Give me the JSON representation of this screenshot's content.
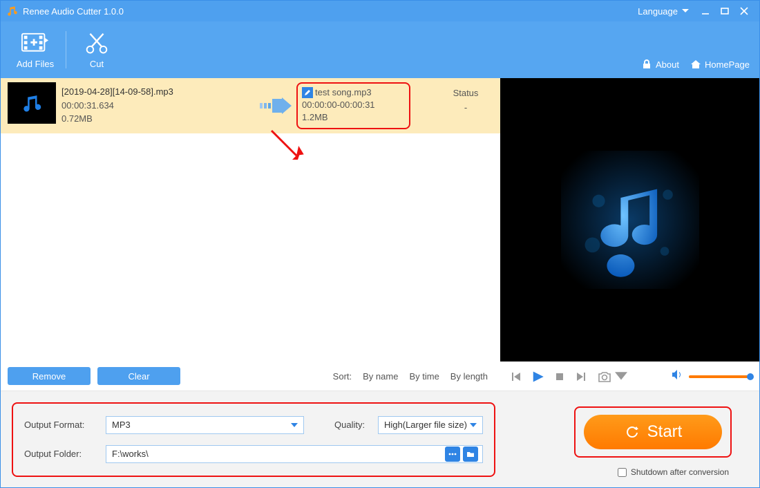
{
  "titlebar": {
    "title": "Renee Audio Cutter 1.0.0",
    "language_label": "Language"
  },
  "toolbar": {
    "add_files_label": "Add Files",
    "cut_label": "Cut",
    "about_label": "About",
    "homepage_label": "HomePage"
  },
  "list": {
    "item": {
      "source_name": "[2019-04-28][14-09-58].mp3",
      "source_duration": "00:00:31.634",
      "source_size": "0.72MB",
      "dest_name": "test song.mp3",
      "dest_range": "00:00:00-00:00:31",
      "dest_size": "1.2MB",
      "status_header": "Status",
      "status_value": "-"
    }
  },
  "actions": {
    "remove_label": "Remove",
    "clear_label": "Clear"
  },
  "sort": {
    "label": "Sort:",
    "by_name": "By name",
    "by_time": "By time",
    "by_length": "By length"
  },
  "settings": {
    "output_format_label": "Output Format:",
    "output_format_value": "MP3",
    "quality_label": "Quality:",
    "quality_value": "High(Larger file size)",
    "output_folder_label": "Output Folder:",
    "output_folder_value": "F:\\works\\"
  },
  "start": {
    "label": "Start",
    "checkbox_label": "Shutdown after conversion"
  }
}
